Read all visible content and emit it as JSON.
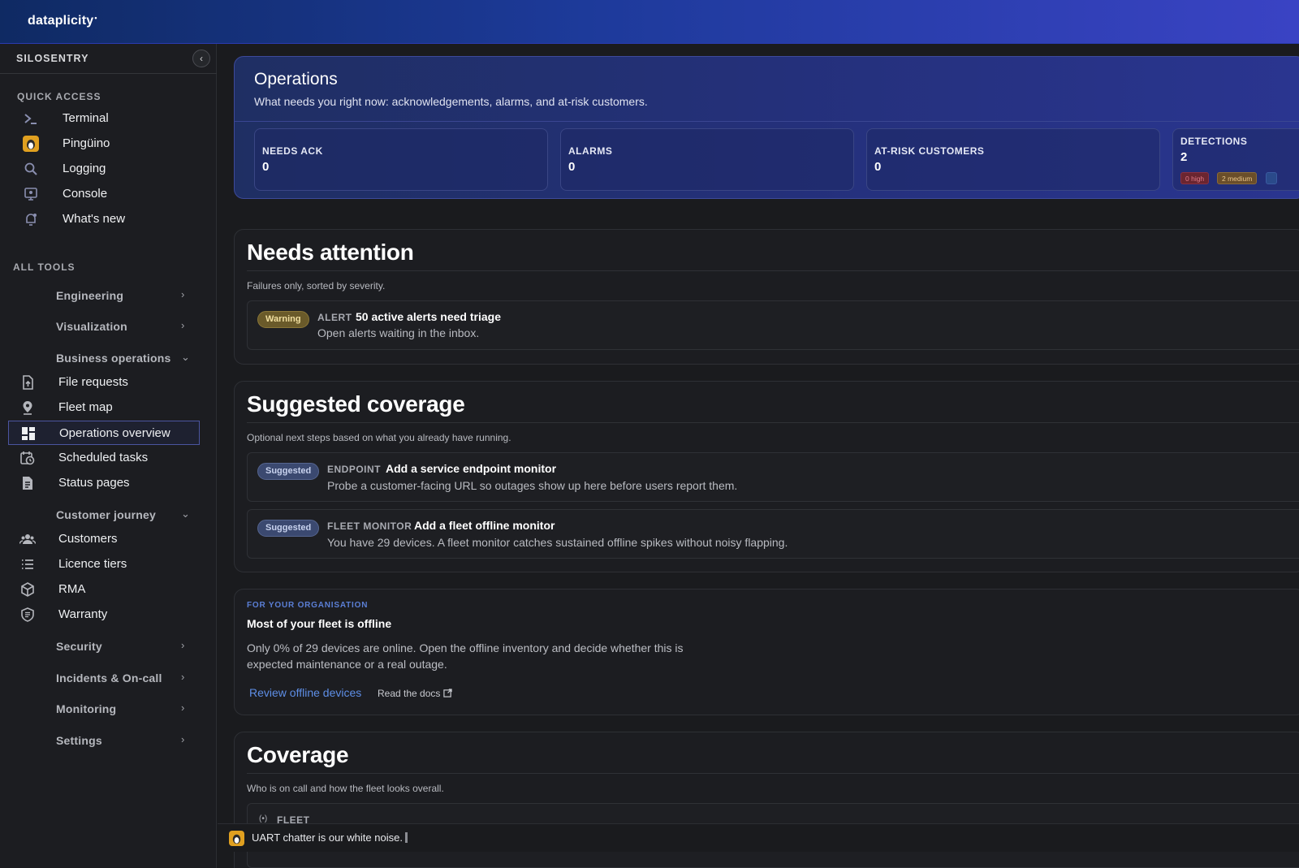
{
  "app": {
    "logo": "dataplicity",
    "logo_mark": "•"
  },
  "sidebar": {
    "org": "SILOSENTRY",
    "collapse_icon": "‹",
    "quick_access_label": "QUICK ACCESS",
    "quick_access": [
      {
        "label": "Terminal",
        "icon": "terminal-icon"
      },
      {
        "label": "Pingüino",
        "icon": "penguin-icon"
      },
      {
        "label": "Logging",
        "icon": "search-icon"
      },
      {
        "label": "Console",
        "icon": "console-icon"
      },
      {
        "label": "What's new",
        "icon": "bell-icon"
      }
    ],
    "all_tools_label": "ALL TOOLS",
    "groups": {
      "engineering": "Engineering",
      "visualization": "Visualization",
      "business_operations": "Business operations",
      "customer_journey": "Customer journey",
      "security": "Security",
      "incidents": "Incidents & On-call",
      "monitoring": "Monitoring",
      "settings": "Settings"
    },
    "business_items": [
      {
        "label": "File requests",
        "icon": "file-upload-icon"
      },
      {
        "label": "Fleet map",
        "icon": "map-pin-icon"
      },
      {
        "label": "Operations overview",
        "icon": "dashboard-icon"
      },
      {
        "label": "Scheduled tasks",
        "icon": "calendar-clock-icon"
      },
      {
        "label": "Status pages",
        "icon": "document-icon"
      }
    ],
    "customer_items": [
      {
        "label": "Customers",
        "icon": "users-icon"
      },
      {
        "label": "Licence tiers",
        "icon": "list-icon"
      },
      {
        "label": "RMA",
        "icon": "package-icon"
      },
      {
        "label": "Warranty",
        "icon": "shield-icon"
      }
    ]
  },
  "operations": {
    "title": "Operations",
    "subtitle": "What needs you right now: acknowledgements, alarms, and at-risk customers.",
    "stats": [
      {
        "label": "NEEDS ACK",
        "value": "0"
      },
      {
        "label": "ALARMS",
        "value": "0"
      },
      {
        "label": "AT-RISK CUSTOMERS",
        "value": "0"
      },
      {
        "label": "DETECTIONS",
        "value": "2"
      }
    ],
    "detection_pills": [
      "0 high",
      "2 medium"
    ]
  },
  "needs_attention": {
    "title": "Needs attention",
    "description": "Failures only, sorted by severity.",
    "items": [
      {
        "badge": "Warning",
        "kind": "ALERT",
        "title": "50 active alerts need triage",
        "subtitle": "Open alerts waiting in the inbox."
      }
    ]
  },
  "suggested": {
    "title": "Suggested coverage",
    "description": "Optional next steps based on what you already have running.",
    "items": [
      {
        "badge": "Suggested",
        "kind": "ENDPOINT",
        "title": "Add a service endpoint monitor",
        "subtitle": "Probe a customer-facing URL so outages show up here before users report them."
      },
      {
        "badge": "Suggested",
        "kind": "FLEET MONITOR",
        "title": "Add a fleet offline monitor",
        "subtitle": "You have 29 devices. A fleet monitor catches sustained offline spikes without noisy flapping."
      }
    ]
  },
  "org_notice": {
    "kicker": "FOR YOUR ORGANISATION",
    "title": "Most of your fleet is offline",
    "body": "Only 0% of 29 devices are online. Open the offline inventory and decide whether this is expected maintenance or a real outage.",
    "link": "Review offline devices",
    "docs": "Read the docs"
  },
  "coverage": {
    "title": "Coverage",
    "description": "Who is on call and how the fleet looks overall.",
    "fleet_label": "FLEET"
  },
  "statusbar": {
    "message": "UART chatter is our white noise."
  }
}
